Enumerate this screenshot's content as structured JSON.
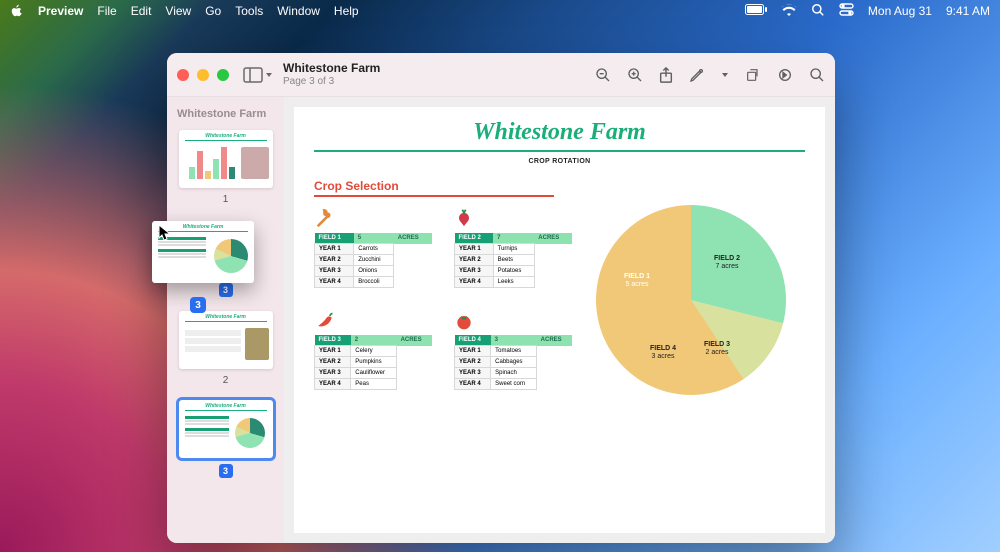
{
  "menubar": {
    "app": "Preview",
    "items": [
      "File",
      "Edit",
      "View",
      "Go",
      "Tools",
      "Window",
      "Help"
    ],
    "date": "Mon Aug 31",
    "time": "9:41 AM"
  },
  "window": {
    "title": "Whitestone Farm",
    "subtitle": "Page 3 of 3",
    "sidebar_title": "Whitestone Farm",
    "thumbs": [
      {
        "num": "1",
        "badge": null,
        "selected": false
      },
      {
        "num": null,
        "badge": "3",
        "selected": false
      },
      {
        "num": "2",
        "badge": null,
        "selected": false
      },
      {
        "num": null,
        "badge": "3",
        "selected": true
      }
    ]
  },
  "doc": {
    "title": "Whitestone Farm",
    "subtitle": "CROP ROTATION",
    "section": "Crop Selection",
    "tables": [
      {
        "field": "FIELD 1",
        "acres_n": "5",
        "acres_l": "ACRES",
        "rows": [
          [
            "YEAR 1",
            "Carrots"
          ],
          [
            "YEAR 2",
            "Zucchini"
          ],
          [
            "YEAR 3",
            "Onions"
          ],
          [
            "YEAR 4",
            "Broccoli"
          ]
        ],
        "icon": "carrot",
        "color": "#e28a3a"
      },
      {
        "field": "FIELD 2",
        "acres_n": "7",
        "acres_l": "ACRES",
        "rows": [
          [
            "YEAR 1",
            "Turnips"
          ],
          [
            "YEAR 2",
            "Beets"
          ],
          [
            "YEAR 3",
            "Potatoes"
          ],
          [
            "YEAR 4",
            "Leeks"
          ]
        ],
        "icon": "beet",
        "color": "#d03a4a"
      },
      {
        "field": "FIELD 3",
        "acres_n": "2",
        "acres_l": "ACRES",
        "rows": [
          [
            "YEAR 1",
            "Celery"
          ],
          [
            "YEAR 2",
            "Pumpkins"
          ],
          [
            "YEAR 3",
            "Cauliflower"
          ],
          [
            "YEAR 4",
            "Peas"
          ]
        ],
        "icon": "chili",
        "color": "#e24a3a"
      },
      {
        "field": "FIELD 4",
        "acres_n": "3",
        "acres_l": "ACRES",
        "rows": [
          [
            "YEAR 1",
            "Tomatoes"
          ],
          [
            "YEAR 2",
            "Cabbages"
          ],
          [
            "YEAR 3",
            "Spinach"
          ],
          [
            "YEAR 4",
            "Sweet corn"
          ]
        ],
        "icon": "tomato",
        "color": "#e24a3a"
      }
    ]
  },
  "chart_data": {
    "type": "pie",
    "series": [
      {
        "name": "FIELD 1",
        "label2": "5 acres",
        "value": 5,
        "color": "#2a8a72"
      },
      {
        "name": "FIELD 2",
        "label2": "7 acres",
        "value": 7,
        "color": "#8fe2b2"
      },
      {
        "name": "FIELD 3",
        "label2": "2 acres",
        "value": 2,
        "color": "#d8e29e"
      },
      {
        "name": "FIELD 4",
        "label2": "3 acres",
        "value": 3,
        "color": "#f0c878"
      }
    ]
  },
  "drag": {
    "badge": "3"
  }
}
